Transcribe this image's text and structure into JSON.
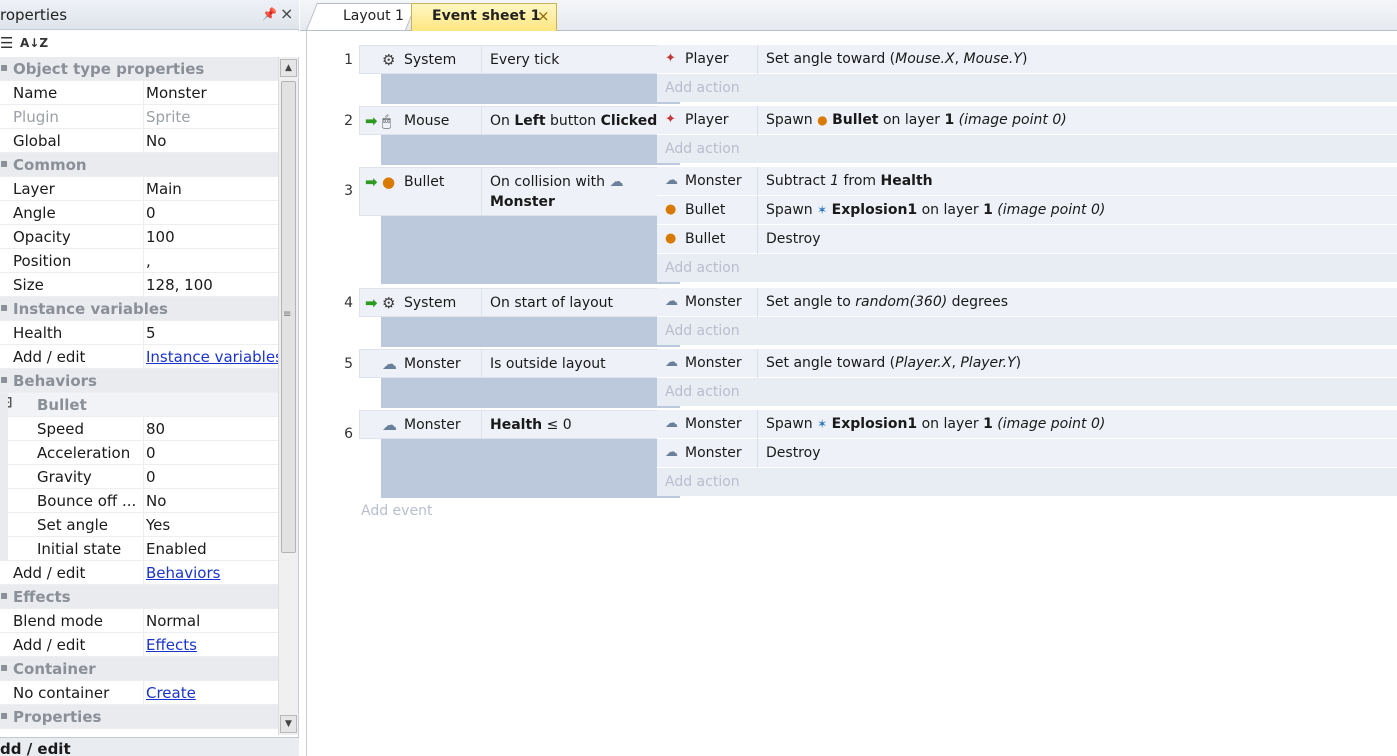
{
  "properties_panel": {
    "title": "roperties",
    "pin_icon": "pin-icon",
    "close_icon": "×",
    "toolbar": {
      "categorized_icon": "☰",
      "sort_icon": "A↓Z"
    },
    "rows": [
      {
        "kind": "cat",
        "k": "Object type properties"
      },
      {
        "kind": "row",
        "k": "Name",
        "v": "Monster"
      },
      {
        "kind": "row",
        "k": "Plugin",
        "v": "Sprite",
        "dim": true
      },
      {
        "kind": "row",
        "k": "Global",
        "v": "No"
      },
      {
        "kind": "cat",
        "k": "Common"
      },
      {
        "kind": "row",
        "k": "Layer",
        "v": "Main"
      },
      {
        "kind": "row",
        "k": "Angle",
        "v": "0"
      },
      {
        "kind": "row",
        "k": "Opacity",
        "v": "100"
      },
      {
        "kind": "row",
        "k": "Position",
        "v": ","
      },
      {
        "kind": "row",
        "k": "Size",
        "v": "128, 100"
      },
      {
        "kind": "cat",
        "k": "Instance variables"
      },
      {
        "kind": "row",
        "k": "Health",
        "v": "5"
      },
      {
        "kind": "row",
        "k": "Add / edit",
        "v": "Instance variables",
        "link": true
      },
      {
        "kind": "cat",
        "k": "Behaviors"
      },
      {
        "kind": "sub",
        "k": "Bullet"
      },
      {
        "kind": "child",
        "k": "Speed",
        "v": "80"
      },
      {
        "kind": "child",
        "k": "Acceleration",
        "v": "0"
      },
      {
        "kind": "child",
        "k": "Gravity",
        "v": "0"
      },
      {
        "kind": "child",
        "k": "Bounce off ...",
        "v": "No"
      },
      {
        "kind": "child",
        "k": "Set angle",
        "v": "Yes"
      },
      {
        "kind": "child",
        "k": "Initial state",
        "v": "Enabled"
      },
      {
        "kind": "row",
        "k": "Add / edit",
        "v": "Behaviors",
        "link": true
      },
      {
        "kind": "cat",
        "k": "Effects"
      },
      {
        "kind": "row",
        "k": "Blend mode",
        "v": "Normal"
      },
      {
        "kind": "row",
        "k": "Add / edit",
        "v": "Effects",
        "link": true
      },
      {
        "kind": "cat",
        "k": "Container"
      },
      {
        "kind": "row",
        "k": "No container",
        "v": "Create",
        "link": true
      },
      {
        "kind": "cat",
        "k": "Properties"
      }
    ],
    "footer": "dd / edit"
  },
  "tabs": [
    {
      "label": "Layout 1",
      "active": false
    },
    {
      "label": "Event sheet 1",
      "active": true,
      "close": "×"
    }
  ],
  "events": [
    {
      "num": "1",
      "conditions": [
        {
          "icon": "gear-icon",
          "obj": "System",
          "text": "Every tick",
          "trigger": false
        }
      ],
      "actions": [
        {
          "icon": "player-icon",
          "obj": "Player",
          "text": [
            "Set angle toward (",
            {
              "i": "Mouse.X"
            },
            ", ",
            {
              "i": "Mouse.Y"
            },
            ")"
          ]
        }
      ],
      "add_action": "Add action"
    },
    {
      "num": "2",
      "conditions": [
        {
          "icon": "mouse-icon",
          "obj": "Mouse",
          "text": [
            "On ",
            {
              "b": "Left"
            },
            " button ",
            {
              "b": "Clicked"
            }
          ],
          "trigger": true
        }
      ],
      "actions": [
        {
          "icon": "player-icon",
          "obj": "Player",
          "text": [
            "Spawn  ",
            {
              "icon": "bullet-icon"
            },
            " ",
            {
              "b": "Bullet"
            },
            " on layer ",
            {
              "b": "1"
            },
            " ",
            {
              "i": "(image point 0)"
            }
          ]
        }
      ],
      "add_action": "Add action"
    },
    {
      "num": "3",
      "conditions": [
        {
          "icon": "bullet-icon",
          "obj": "Bullet",
          "text": "On collision with",
          "text2": "Monster",
          "trigger": true
        }
      ],
      "actions": [
        {
          "icon": "monster-icon",
          "obj": "Monster",
          "text": [
            "Subtract ",
            {
              "i": "1"
            },
            " from ",
            {
              "b": "Health"
            }
          ]
        },
        {
          "icon": "bullet-icon",
          "obj": "Bullet",
          "text": [
            "Spawn  ",
            {
              "icon": "explosion-icon"
            },
            " ",
            {
              "b": "Explosion1"
            },
            " on layer ",
            {
              "b": "1"
            },
            " ",
            {
              "i": "(image point 0)"
            }
          ]
        },
        {
          "icon": "bullet-icon",
          "obj": "Bullet",
          "text": [
            "Destroy"
          ]
        }
      ],
      "add_action": "Add action"
    },
    {
      "num": "4",
      "conditions": [
        {
          "icon": "gear-icon",
          "obj": "System",
          "text": "On start of layout",
          "trigger": true
        }
      ],
      "actions": [
        {
          "icon": "monster-icon",
          "obj": "Monster",
          "text": [
            "Set angle to ",
            {
              "i": "random(360)"
            },
            "  degrees"
          ]
        }
      ],
      "add_action": "Add action"
    },
    {
      "num": "5",
      "conditions": [
        {
          "icon": "monster-icon",
          "obj": "Monster",
          "text": "Is outside layout",
          "trigger": false
        }
      ],
      "actions": [
        {
          "icon": "monster-icon",
          "obj": "Monster",
          "text": [
            "Set angle toward (",
            {
              "i": "Player.X"
            },
            ", ",
            {
              "i": "Player.Y"
            },
            ")"
          ]
        }
      ],
      "add_action": "Add action"
    },
    {
      "num": "6",
      "conditions": [
        {
          "icon": "monster-icon",
          "obj": "Monster",
          "text": [
            {
              "b": "Health"
            },
            " ≤ 0"
          ],
          "trigger": false
        }
      ],
      "actions": [
        {
          "icon": "monster-icon",
          "obj": "Monster",
          "text": [
            "Spawn  ",
            {
              "icon": "explosion-icon"
            },
            " ",
            {
              "b": "Explosion1"
            },
            " on layer ",
            {
              "b": "1"
            },
            " ",
            {
              "i": "(image point 0)"
            }
          ]
        },
        {
          "icon": "monster-icon",
          "obj": "Monster",
          "text": [
            "Destroy"
          ]
        }
      ],
      "add_action": "Add action"
    }
  ],
  "add_event": "Add event",
  "icons": {
    "gear-icon": "⚙",
    "mouse-icon": "🖱",
    "bullet-icon": "●",
    "monster-icon": "☁",
    "player-icon": "✦",
    "explosion-icon": "✶",
    "trigger-arrow": "➡"
  },
  "colors": {
    "event_block": "#bcc8db",
    "condition_bg": "#eef1f7",
    "active_tab": "#ffe680",
    "link": "#1a33cc",
    "trigger_arrow": "#2e9a22"
  }
}
